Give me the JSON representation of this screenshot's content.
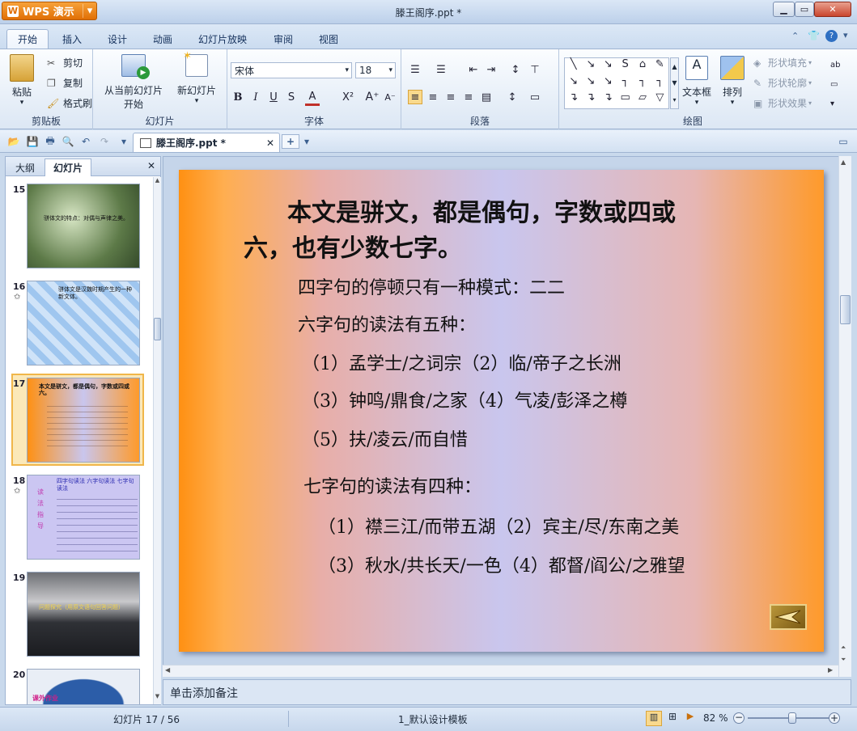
{
  "app": {
    "name": "WPS 演示",
    "window_title": "滕王阁序.ppt *"
  },
  "ribbon_tabs": [
    "开始",
    "插入",
    "设计",
    "动画",
    "幻灯片放映",
    "审阅",
    "视图"
  ],
  "ribbon": {
    "clipboard": {
      "paste": "粘贴",
      "cut": "剪切",
      "copy": "复制",
      "format_painter": "格式刷",
      "label": "剪贴板"
    },
    "slides": {
      "from_current_1": "从当前幻灯片",
      "from_current_2": "开始",
      "new_slide": "新幻灯片",
      "label": "幻灯片"
    },
    "font": {
      "name": "宋体",
      "size": "18",
      "bold": "B",
      "italic": "I",
      "underline": "U",
      "strike": "S",
      "label": "字体"
    },
    "paragraph": {
      "label": "段落"
    },
    "drawing": {
      "textbox": "文本框",
      "arrange": "排列",
      "shape_fill": "形状填充",
      "shape_outline": "形状轮廓",
      "shape_effect": "形状效果",
      "label": "绘图"
    }
  },
  "doc_tab": {
    "name": "滕王阁序.ppt *"
  },
  "panel": {
    "tab_outline": "大纲",
    "tab_slides": "幻灯片"
  },
  "thumbnails": [
    {
      "num": "15",
      "text": "骈体文的特点：对偶与声律之美。"
    },
    {
      "num": "16",
      "text": "骈体文是汉魏时期产生的一种新文体。"
    },
    {
      "num": "17",
      "text": "本文是骈文，都是偶句，字数或四或六。"
    },
    {
      "num": "18",
      "text": "四字句读法 六字句读法 七字句读法"
    },
    {
      "num": "19",
      "text": "问题探究（用原文语句回答问题）"
    },
    {
      "num": "20",
      "text": "课外作业"
    }
  ],
  "slide": {
    "title_line1": "本文是骈文，都是偶句，字数或四或",
    "title_line2": "六，也有少数七字。",
    "p1": "四字句的停顿只有一种模式：二二",
    "p2": "六字句的读法有五种：",
    "p3": "（1）孟学士/之词宗（2）临/帝子之长洲",
    "p4": "（3）钟鸣/鼎食/之家（4）气凌/彭泽之樽",
    "p5": "（5）扶/凌云/而自惜",
    "p6": "七字句的读法有四种：",
    "p7": "（1）襟三江/而带五湖（2）宾主/尽/东南之美",
    "p8": "（3）秋水/共长天/一色（4）都督/阎公/之雅望"
  },
  "notes": {
    "placeholder": "单击添加备注"
  },
  "status": {
    "slide_count": "幻灯片 17 / 56",
    "template": "1_默认设计模板",
    "zoom": "82 %",
    "zoom_level": 0.55
  }
}
